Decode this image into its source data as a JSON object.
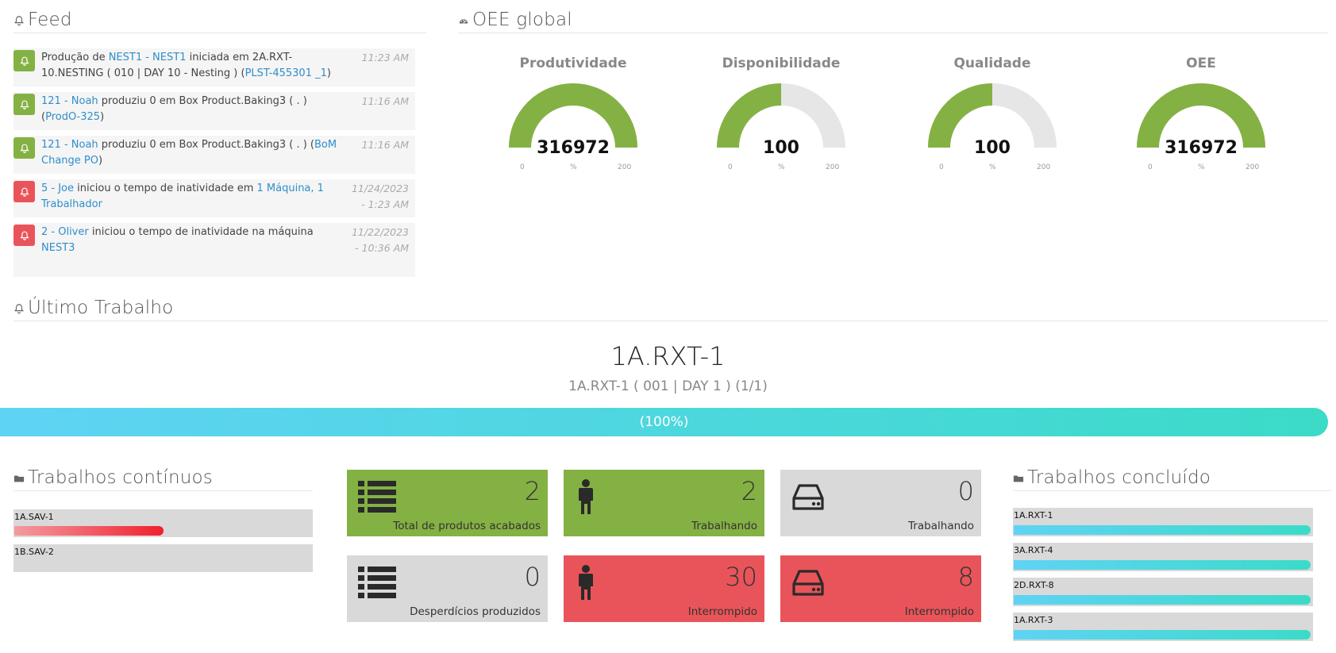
{
  "feed": {
    "title": "Feed",
    "icon": "bell-icon",
    "items": [
      {
        "type": "success",
        "pre": "Produção de ",
        "link1": "NEST1 - NEST1",
        "mid": " iniciada em 2A.RXT-10.NESTING ( 010 | DAY 10 - Nesting ) (",
        "link2": "PLST-455301 _1",
        "post": ")",
        "time": "11:23 AM"
      },
      {
        "type": "success",
        "pre": "",
        "link1": "121 - Noah",
        "mid": " produziu 0 em Box Product.Baking3 ( . ) (",
        "link2": "ProdO-325",
        "post": ")",
        "time": "11:16 AM"
      },
      {
        "type": "success",
        "pre": "",
        "link1": "121 - Noah",
        "mid": " produziu 0 em Box Product.Baking3 ( . ) (",
        "link2": "BoM Change PO",
        "post": ")",
        "time": "11:16 AM"
      },
      {
        "type": "alert",
        "pre": "",
        "link1": "5 - Joe",
        "mid": " iniciou o tempo de inatividade em ",
        "link2": "1 Máquina, 1 Trabalhador",
        "post": "",
        "time": "11/24/2023 - 1:23 AM"
      },
      {
        "type": "alert",
        "pre": "",
        "link1": "2 - Oliver",
        "mid": " iniciou o tempo de inatividade na máquina ",
        "link2": "NEST3",
        "post": "",
        "time": "11/22/2023 - 10:36 AM"
      }
    ]
  },
  "oee": {
    "title": "OEE global",
    "icon": "dashboard-icon",
    "gauges": [
      {
        "label": "Produtividade",
        "value": "316972",
        "fill": 1.0,
        "min": "0",
        "unit": "%",
        "max": "200"
      },
      {
        "label": "Disponibilidade",
        "value": "100",
        "fill": 0.5,
        "min": "0",
        "unit": "%",
        "max": "200"
      },
      {
        "label": "Qualidade",
        "value": "100",
        "fill": 0.5,
        "min": "0",
        "unit": "%",
        "max": "200"
      },
      {
        "label": "OEE",
        "value": "316972",
        "fill": 1.0,
        "min": "0",
        "unit": "%",
        "max": "200"
      }
    ],
    "colors": {
      "fill": "#84b143",
      "track": "#e6e6e6"
    }
  },
  "last_job": {
    "title": "Último Trabalho",
    "icon": "bell-icon",
    "name": "1A.RXT-1",
    "detail": "1A.RXT-1 ( 001 | DAY 1 ) (1/1)",
    "progress_label": "(100%)",
    "progress": 1.0
  },
  "continuous": {
    "title": "Trabalhos contínuos",
    "icon": "folder-icon",
    "items": [
      {
        "label": "1A.SAV-1",
        "progress": 0.5
      },
      {
        "label": "1B.SAV-2",
        "progress": 0.0
      }
    ]
  },
  "tiles": [
    {
      "icon": "list-icon",
      "value": "2",
      "label": "Total de produtos acabados",
      "color": "green"
    },
    {
      "icon": "person-icon",
      "value": "2",
      "label": "Trabalhando",
      "color": "green"
    },
    {
      "icon": "hdd-icon",
      "value": "0",
      "label": "Trabalhando",
      "color": "gray"
    },
    {
      "icon": "list-icon",
      "value": "0",
      "label": "Desperdícios produzidos",
      "color": "gray"
    },
    {
      "icon": "person-icon",
      "value": "30",
      "label": "Interrompido",
      "color": "red"
    },
    {
      "icon": "hdd-icon",
      "value": "8",
      "label": "Interrompido",
      "color": "red"
    }
  ],
  "completed": {
    "title": "Trabalhos concluído",
    "icon": "folder-icon",
    "items": [
      {
        "label": "1A.RXT-1",
        "progress": 1.0
      },
      {
        "label": "3A.RXT-4",
        "progress": 1.0
      },
      {
        "label": "2D.RXT-8",
        "progress": 1.0
      },
      {
        "label": "1A.RXT-3",
        "progress": 1.0
      }
    ]
  }
}
